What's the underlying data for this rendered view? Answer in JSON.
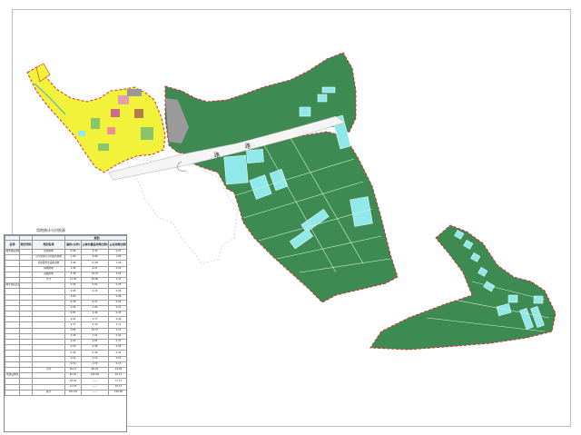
{
  "table": {
    "title": "用地统计与对照表",
    "header_group": "规划",
    "col_headers": [
      "名称",
      "类别代码",
      "类别名称",
      "面积(公顷)",
      "占城市建设用地比例(%)",
      "占总用地比例(%)"
    ],
    "rows": [
      [
        "",
        "",
        "居住用地",
        "0.56",
        "2.35",
        "0.27"
      ],
      [
        "",
        "",
        "公共管理与公共服务用地",
        "1.69",
        "8.08",
        "1.80"
      ],
      [
        "",
        "",
        "商业服务业设施用地",
        "2.66",
        "11.35",
        "1.29"
      ],
      [
        "",
        "",
        "绿地用地",
        "1.05",
        "6.07",
        "0.52"
      ],
      [
        "",
        "",
        "道路用地",
        "5.36",
        "19.37",
        "3.02"
      ],
      [
        "",
        "",
        "合计",
        "11.30",
        "56.80",
        "5.47"
      ],
      [
        "",
        "",
        "",
        "0.56",
        "0.62",
        "0.35"
      ],
      [
        "",
        "",
        "",
        "0.95",
        "0.70",
        "0.95"
      ],
      [
        "",
        "",
        "",
        "4.00",
        "",
        "0.96"
      ],
      [
        "",
        "",
        "",
        "0.48",
        "0.31",
        "0.16"
      ],
      [
        "",
        "",
        "",
        "0.45",
        "1.09",
        "0.31"
      ],
      [
        "",
        "",
        "",
        "0.87",
        "2.40",
        "0.43"
      ],
      [
        "",
        "",
        "",
        "0.91",
        "0.77",
        "0.40"
      ],
      [
        "",
        "",
        "",
        "3.57",
        "4.39",
        "1.17"
      ],
      [
        "",
        "",
        "",
        "0.85",
        "10.37",
        "1.13"
      ],
      [
        "",
        "",
        "",
        "0.45",
        "1.01",
        "0.22"
      ],
      [
        "",
        "",
        "",
        "0.20",
        "0.95",
        "0.37"
      ],
      [
        "",
        "",
        "",
        "0.30",
        "0.46",
        "0.29"
      ],
      [
        "",
        "",
        "",
        "0.44",
        "0.40",
        "0.24"
      ],
      [
        "",
        "",
        "",
        "0.14",
        "0.10",
        "0.07"
      ],
      [
        "",
        "",
        "",
        "0.50",
        "1.33",
        "0.13"
      ],
      [
        "",
        "",
        "小计",
        "26.13",
        "60.22",
        "13.94"
      ],
      [
        "",
        "",
        "",
        "45.91",
        "100.00",
        "20.13"
      ],
      [
        "",
        "",
        "",
        "35.62",
        "——",
        "71.17"
      ],
      [
        "",
        "",
        "",
        "11.53",
        "——",
        "32.17"
      ],
      [
        "",
        "",
        "总计",
        "201.10",
        "——",
        "100.00"
      ]
    ],
    "side_labels": {
      "group_a": "城市建设用地",
      "group_b": "城乡居民点建设用地",
      "group_c": "非建设用地"
    }
  },
  "map": {
    "road_labels": [
      "路",
      "路"
    ],
    "colors": {
      "farmland": "#3d8a52",
      "water": "#8fe8ea",
      "residential": "#f2f23a",
      "boundary": "#d92b2b",
      "road": "#f5f5f5"
    }
  }
}
